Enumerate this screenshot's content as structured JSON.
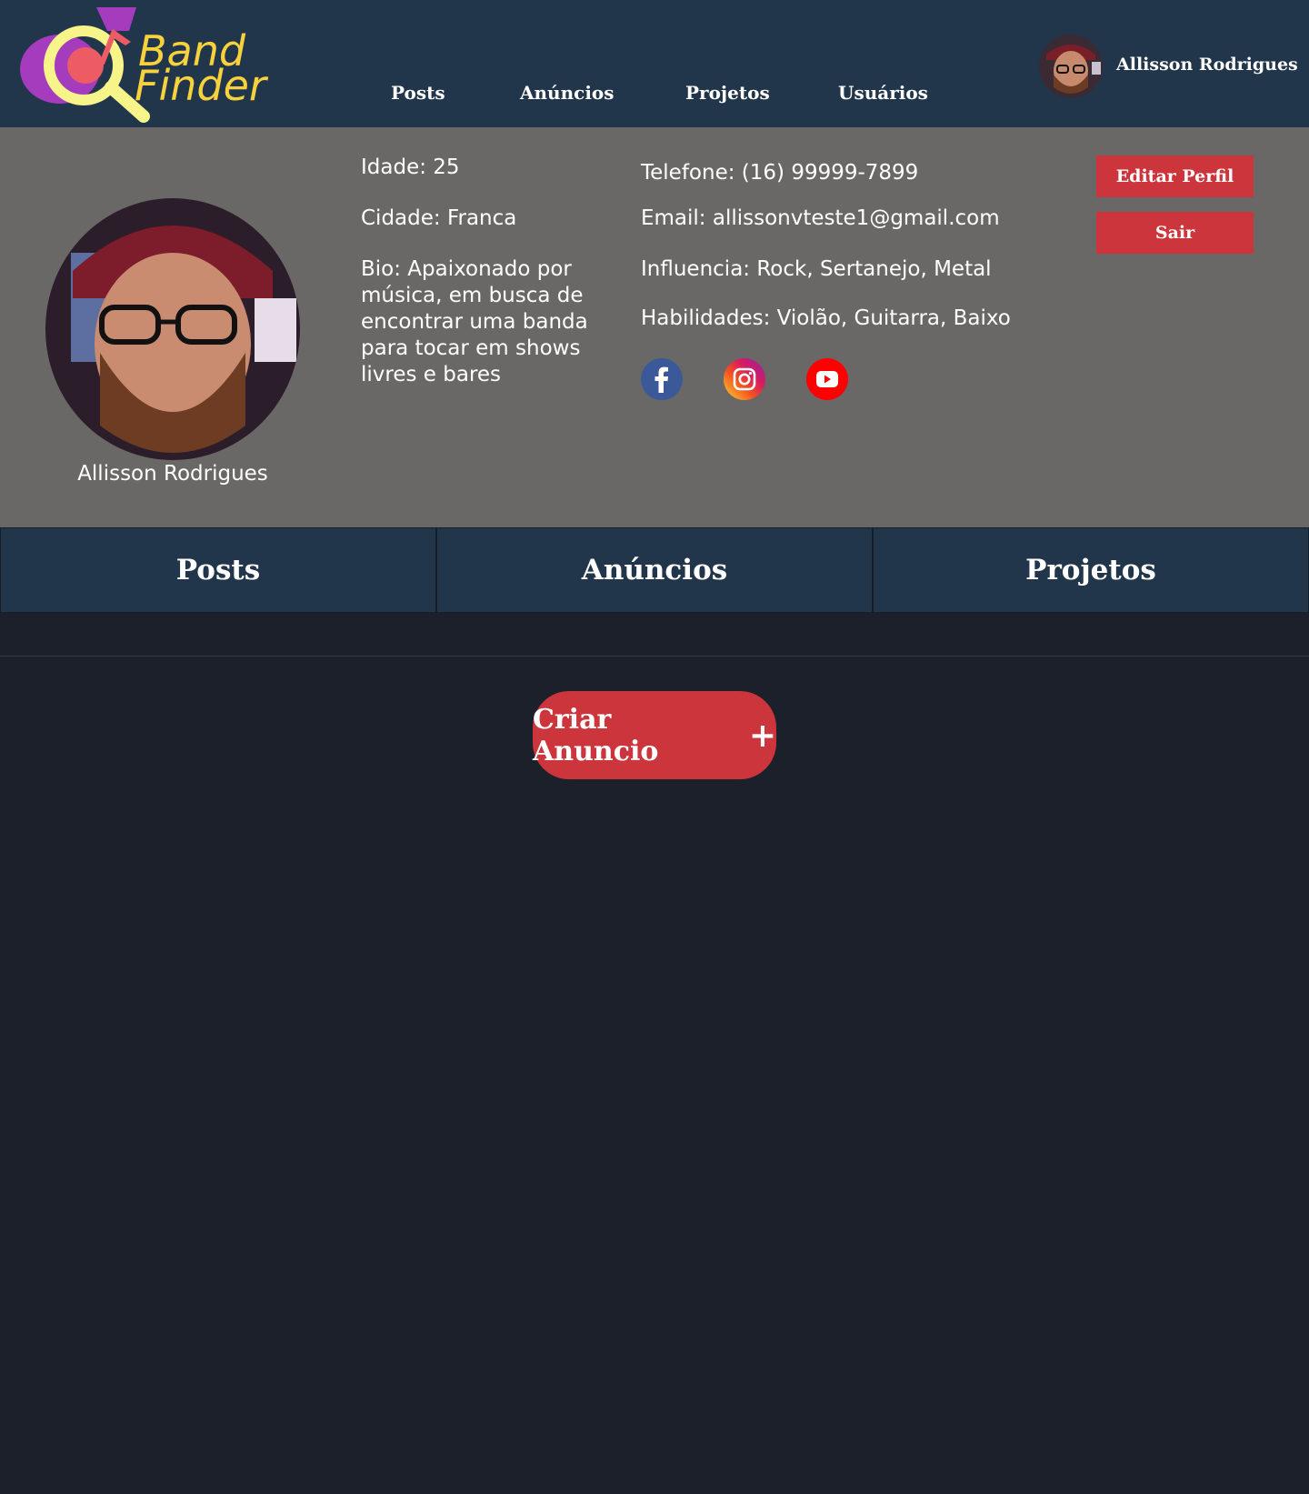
{
  "header": {
    "logo_text_1": "Band",
    "logo_text_2": "Finder",
    "nav": [
      "Posts",
      "Anúncios",
      "Projetos",
      "Usuários"
    ],
    "user_name": "Allisson Rodrigues"
  },
  "profile": {
    "name": "Allisson Rodrigues",
    "age": "Idade: 25",
    "city": "Cidade: Franca",
    "bio": "Bio: Apaixonado por música, em busca de encontrar uma banda para tocar em shows livres e bares",
    "phone": "Telefone: (16) 99999-7899",
    "email": "Email: allissonvteste1@gmail.com",
    "influences": "Influencia: Rock, Sertanejo, Metal",
    "skills": "Habilidades: Violão, Guitarra, Baixo",
    "edit_label": "Editar Perfil",
    "exit_label": "Sair"
  },
  "tabs": [
    "Posts",
    "Anúncios",
    "Projetos"
  ],
  "create_button": {
    "label": "Criar Anuncio",
    "icon": "+"
  },
  "colors": {
    "header_bg": "#22364b",
    "profile_bg": "#6a6767",
    "page_bg": "#1b202b",
    "accent_red": "#cc353c",
    "logo_yellow": "#f7d23c",
    "logo_purple": "#a43cbd"
  }
}
